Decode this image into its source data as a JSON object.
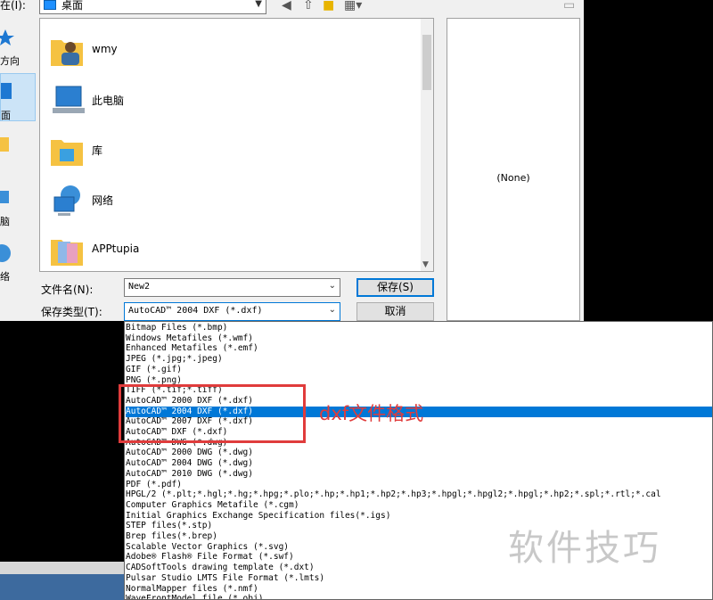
{
  "dialog": {
    "look_in_label": "在(I):",
    "look_in_value": "桌面",
    "toolbar_icons": [
      "back-icon",
      "up-folder-icon",
      "new-folder-icon",
      "view-menu-icon"
    ],
    "places": [
      {
        "label": "方向",
        "icon": "star-icon"
      },
      {
        "label": "面",
        "icon": "desktop-icon"
      },
      {
        "label": "",
        "icon": "folder-icon"
      },
      {
        "label": "脑",
        "icon": "computer-icon"
      },
      {
        "label": "络",
        "icon": "network-icon"
      }
    ],
    "files": [
      {
        "name": "wmy",
        "icon": "user-folder-icon"
      },
      {
        "name": "此电脑",
        "icon": "computer-icon"
      },
      {
        "name": "库",
        "icon": "library-folder-icon"
      },
      {
        "name": "网络",
        "icon": "network-globe-icon"
      },
      {
        "name": "APPtupia",
        "icon": "image-folder-icon"
      }
    ],
    "preview_text": "(None)",
    "filename_label": "文件名(N):",
    "filename_value": "New2",
    "filetype_label": "保存类型(T):",
    "filetype_value": "AutoCAD™ 2004 DXF (*.dxf)",
    "save_button": "保存(S)",
    "cancel_button": "取消"
  },
  "dropdown_options": [
    "Bitmap Files (*.bmp)",
    "Windows Metafiles (*.wmf)",
    "Enhanced Metafiles (*.emf)",
    "JPEG (*.jpg;*.jpeg)",
    "GIF (*.gif)",
    "PNG (*.png)",
    "TIFF (*.tif;*.tiff)",
    "AutoCAD™ 2000 DXF (*.dxf)",
    "AutoCAD™ 2004 DXF (*.dxf)",
    "AutoCAD™ 2007 DXF (*.dxf)",
    "AutoCAD™ DXF (*.dxf)",
    "AutoCAD™ DWG (*.dwg)",
    "AutoCAD™ 2000 DWG (*.dwg)",
    "AutoCAD™ 2004 DWG (*.dwg)",
    "AutoCAD™ 2010 DWG (*.dwg)",
    "PDF (*.pdf)",
    "HPGL/2 (*.plt;*.hgl;*.hg;*.hpg;*.plo;*.hp;*.hp1;*.hp2;*.hp3;*.hpgl;*.hpgl2;*.hpgl;*.hp2;*.spl;*.rtl;*.cal",
    "Computer Graphics Metafile (*.cgm)",
    "Initial Graphics Exchange Specification files(*.igs)",
    "STEP files(*.stp)",
    "Brep files(*.brep)",
    "Scalable Vector Graphics (*.svg)",
    "Adobe® Flash® File Format (*.swf)",
    "CADSoftTools drawing template (*.dxt)",
    "Pulsar Studio LMTS File Format (*.lmts)",
    "NormalMapper files (*.nmf)",
    "WaveFrontModel file (*.obj)"
  ],
  "selected_option_index": 8,
  "annotation": "dxf文件格式",
  "watermark": "软件技巧",
  "colors": {
    "selection": "#0078d7",
    "annotation": "#e03c3c"
  }
}
